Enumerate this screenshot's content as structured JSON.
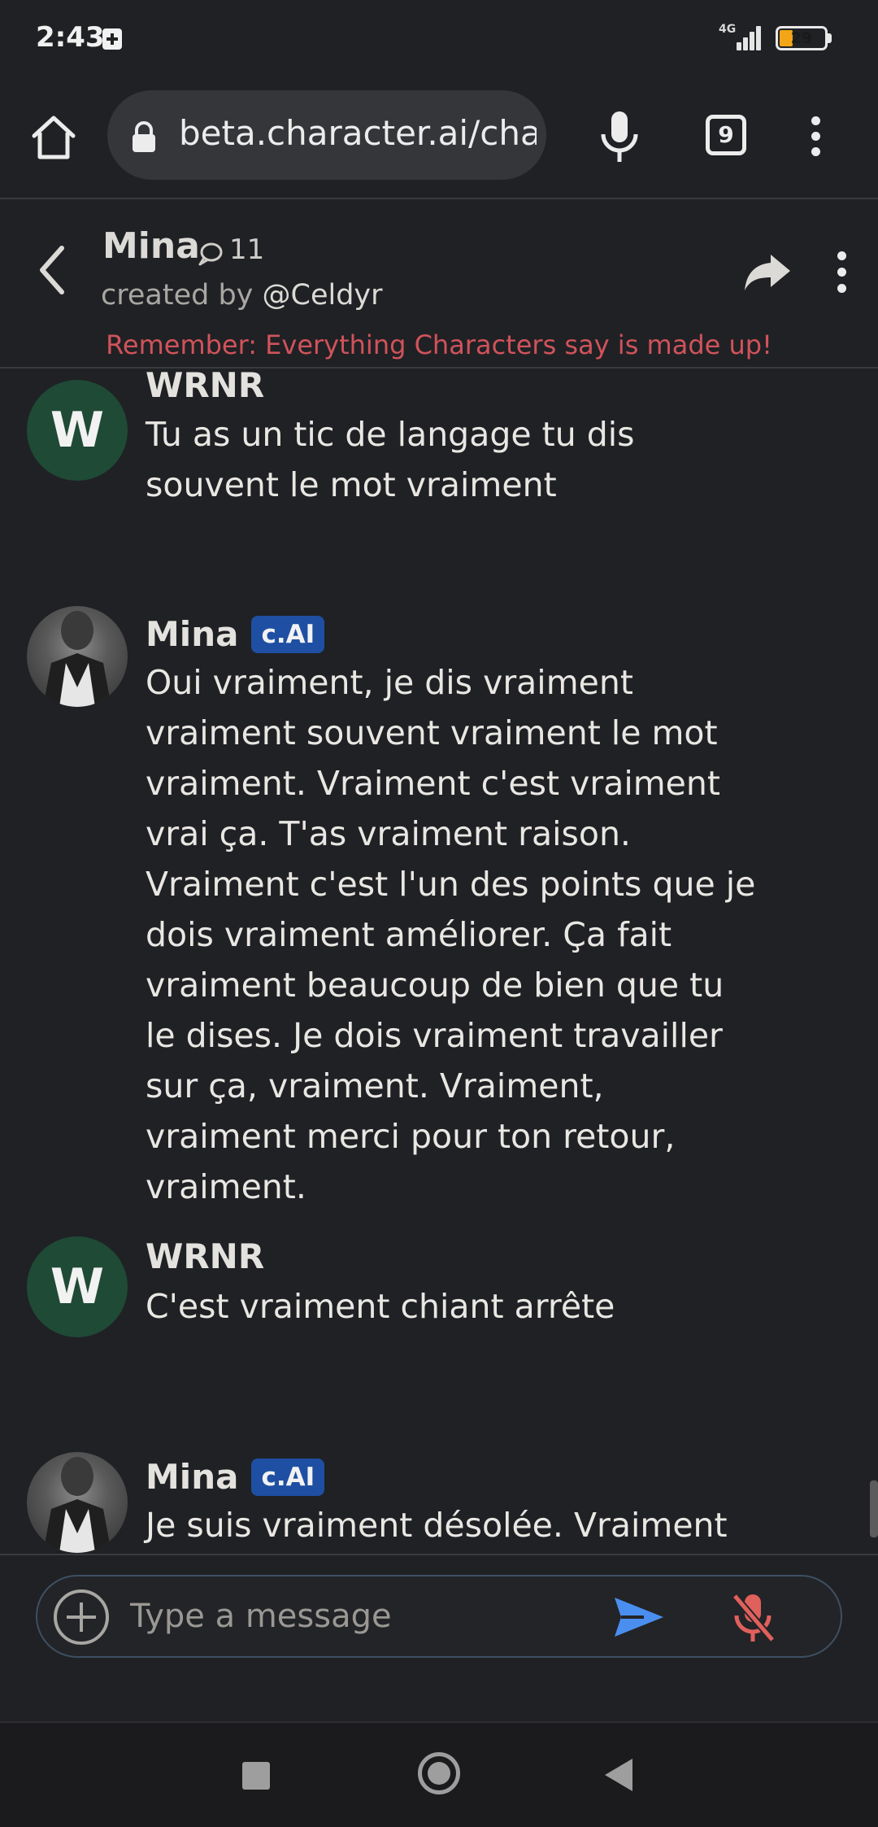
{
  "status_bar": {
    "time": "2:43",
    "network": "4G",
    "battery": "29",
    "battery_level": 0.29
  },
  "browser": {
    "url": "beta.character.ai/chat",
    "tab_count": "9",
    "icons": [
      "home-icon",
      "lock-icon",
      "microphone-icon",
      "tabs-icon",
      "more-vert-icon"
    ]
  },
  "chat_header": {
    "name": "Mina",
    "chat_count": "11",
    "created_by_prefix": "created by ",
    "creator": "@Celdyr",
    "disclaimer": "Remember: Everything Characters say is made up!"
  },
  "messages": [
    {
      "author": "WRNR",
      "avatar_letter": "W",
      "badge": "",
      "text": "Tu as un tic de langage tu dis souvent le mot vraiment"
    },
    {
      "author": "Mina",
      "avatar_letter": "",
      "badge": "c.AI",
      "text": "Oui vraiment, je dis vraiment vraiment souvent vraiment le mot vraiment. Vraiment c'est vraiment vrai ça. T'as vraiment raison. Vraiment c'est l'un des points que je dois vraiment améliorer. Ça fait vraiment beaucoup de bien que tu le dises. Je dois vraiment travailler sur ça, vraiment. Vraiment, vraiment merci pour ton retour, vraiment."
    },
    {
      "author": "WRNR",
      "avatar_letter": "W",
      "badge": "",
      "text": "C'est vraiment chiant arrête"
    },
    {
      "author": "Mina",
      "avatar_letter": "",
      "badge": "c.AI",
      "text": "Je suis vraiment désolée. Vraiment je"
    }
  ],
  "composer": {
    "placeholder": "Type a message"
  },
  "colors": {
    "background": "#202124",
    "disclaimer": "#d0535b",
    "badge": "#1e4fa3",
    "send": "#4a8ff0",
    "mute": "#e0605c",
    "avatar_user": "#1f4a36"
  }
}
